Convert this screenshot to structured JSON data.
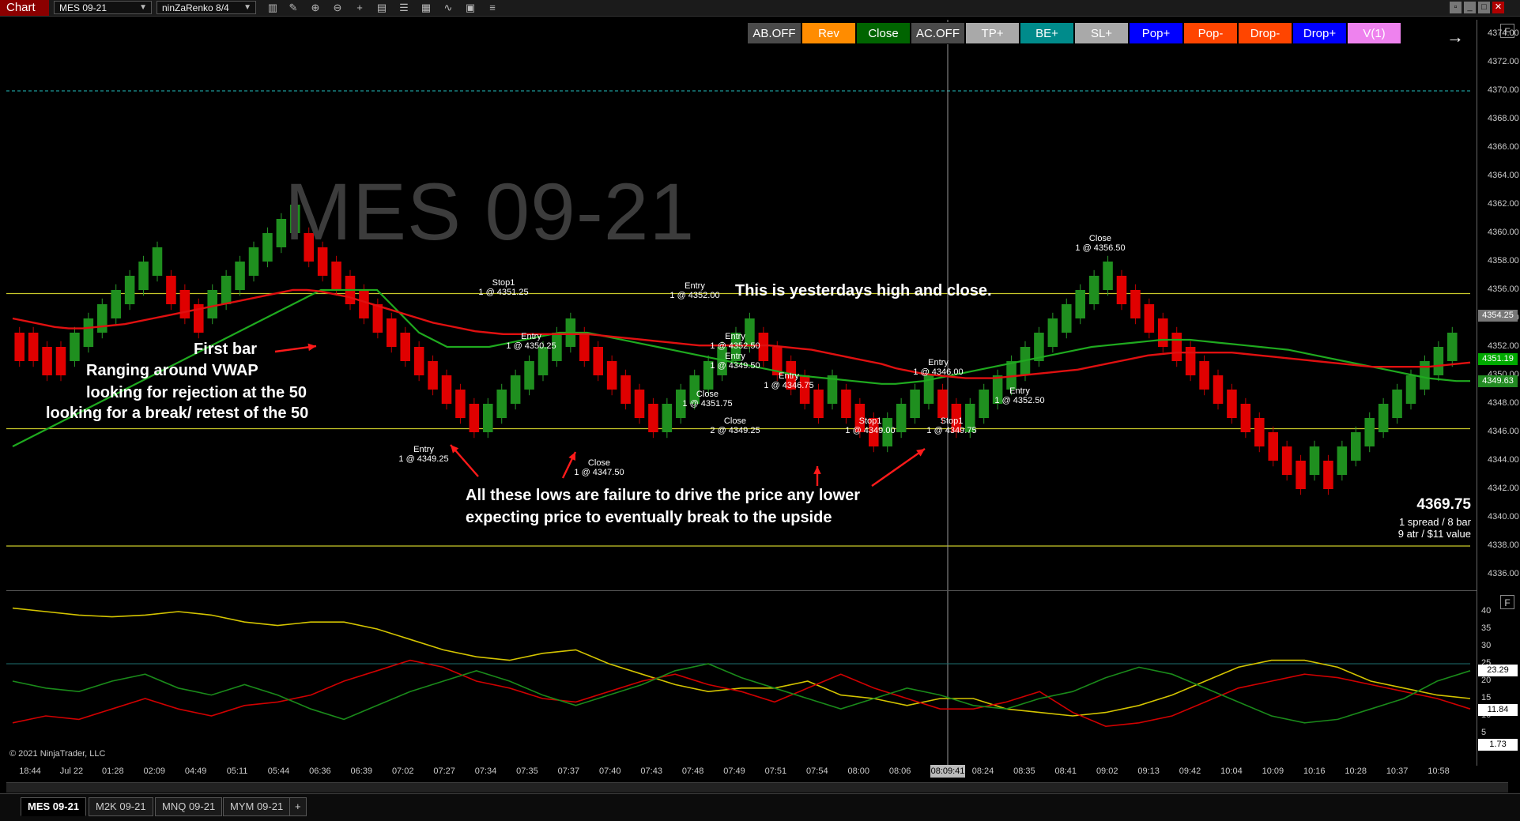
{
  "window": {
    "chart_tab": "Chart",
    "instrument": "MES 09-21",
    "bar_type": "ninZaRenko 8/4",
    "toolbar_icons": [
      "bar-type-icon",
      "pencil-icon",
      "zoom-in-icon",
      "zoom-out-icon",
      "crosshair-icon",
      "properties-icon",
      "data-series-icon",
      "indicators-icon",
      "strategies-icon",
      "templates-icon",
      "list-icon"
    ],
    "window_controls": [
      "tile-icon",
      "restore-icon",
      "maximize-icon",
      "close-icon"
    ]
  },
  "buttons": [
    {
      "label": "AB.OFF",
      "color": "#4a4a4a"
    },
    {
      "label": "Rev",
      "color": "#ff8c00"
    },
    {
      "label": "Close",
      "color": "#006400"
    },
    {
      "label": "AC.OFF",
      "color": "#4a4a4a"
    },
    {
      "label": "TP+",
      "color": "#a9a9a9"
    },
    {
      "label": "BE+",
      "color": "#008b8b"
    },
    {
      "label": "SL+",
      "color": "#a9a9a9"
    },
    {
      "label": "Pop+",
      "color": "#0000ff"
    },
    {
      "label": "Pop-",
      "color": "#ff4500"
    },
    {
      "label": "Drop-",
      "color": "#ff4500"
    },
    {
      "label": "Drop+",
      "color": "#0000ff"
    },
    {
      "label": "V(1)",
      "color": "#ee82ee"
    }
  ],
  "watermark": "MES 09-21",
  "annotations": {
    "yesterday": "This is yesterdays high and close.",
    "first_bar": "First bar",
    "ranging": "Ranging around VWAP",
    "rejection": "looking for rejection at the 50",
    "break_retest": "looking for a break/ retest of the 50",
    "lows1": "All these lows are failure to drive the price any lower",
    "lows2": "expecting price to eventually break to the upside"
  },
  "trade_labels": [
    {
      "title": "Stop1",
      "detail": "1 @ 4351.25"
    },
    {
      "title": "Entry",
      "detail": "1 @ 4350.25"
    },
    {
      "title": "Entry",
      "detail": "1 @ 4349.25"
    },
    {
      "title": "Close",
      "detail": "1 @ 4347.50"
    },
    {
      "title": "Entry",
      "detail": "1 @ 4352.00"
    },
    {
      "title": "Entry",
      "detail": "1 @ 4352.50"
    },
    {
      "title": "Entry",
      "detail": "1 @ 4349.50"
    },
    {
      "title": "Close",
      "detail": "1 @ 4351.75"
    },
    {
      "title": "Close",
      "detail": "2 @ 4349.25"
    },
    {
      "title": "Entry",
      "detail": "1 @ 4346.75"
    },
    {
      "title": "Stop1",
      "detail": "1 @ 4349.00"
    },
    {
      "title": "Entry",
      "detail": "1 @ 4346.00"
    },
    {
      "title": "Stop1",
      "detail": "1 @ 4349.75"
    },
    {
      "title": "Entry",
      "detail": "1 @ 4352.50"
    },
    {
      "title": "Close",
      "detail": "1 @ 4356.50"
    }
  ],
  "info_panel": {
    "price": "4369.75",
    "line1": "1 spread / 8 bar",
    "line2": "9 atr / $11 value"
  },
  "price_axis": [
    "4374.00",
    "4372.00",
    "4370.00",
    "4368.00",
    "4366.00",
    "4364.00",
    "4362.00",
    "4360.00",
    "4358.00",
    "4356.00",
    "4354.00",
    "4352.00",
    "4350.00",
    "4348.00",
    "4346.00",
    "4344.00",
    "4342.00",
    "4340.00",
    "4338.00",
    "4336.00"
  ],
  "price_badges": [
    {
      "label": "4354.25",
      "bg": "#777777",
      "fg": "#ffffff"
    },
    {
      "label": "4351.19",
      "bg": "#00aa00",
      "fg": "#ffffff"
    },
    {
      "label": "4349.63",
      "bg": "#228b22",
      "fg": "#ffffff"
    }
  ],
  "osc_axis": [
    "40",
    "35",
    "30",
    "25",
    "20",
    "15",
    "10",
    "5"
  ],
  "osc_badges": [
    {
      "label": "23.29",
      "bg": "#ffffff",
      "fg": "#000000"
    },
    {
      "label": "11.84",
      "bg": "#ffffff",
      "fg": "#000000"
    },
    {
      "label": "1.73",
      "bg": "#ffffff",
      "fg": "#000000"
    }
  ],
  "time_axis": [
    "18:44",
    "Jul 22",
    "01:28",
    "02:09",
    "04:49",
    "05:11",
    "05:44",
    "06:36",
    "06:39",
    "07:02",
    "07:27",
    "07:34",
    "07:35",
    "07:37",
    "07:40",
    "07:43",
    "07:48",
    "07:49",
    "07:51",
    "07:54",
    "08:00",
    "08:06",
    "08:09:41",
    "08:24",
    "08:35",
    "08:41",
    "09:02",
    "09:13",
    "09:42",
    "10:04",
    "10:09",
    "10:16",
    "10:28",
    "10:37",
    "10:58"
  ],
  "copyright": "© 2021 NinjaTrader, LLC",
  "instrument_tabs": [
    "MES 09-21",
    "M2K 09-21",
    "MNQ 09-21",
    "MYM 09-21"
  ],
  "add_tab": "+",
  "panel_button": "F",
  "chart_data": {
    "type": "candlestick",
    "price_range": [
      4335,
      4375
    ],
    "candles": [
      {
        "o": 4353,
        "c": 4351
      },
      {
        "o": 4353,
        "c": 4351
      },
      {
        "o": 4352,
        "c": 4350
      },
      {
        "o": 4352,
        "c": 4350
      },
      {
        "o": 4351,
        "c": 4353
      },
      {
        "o": 4352,
        "c": 4354
      },
      {
        "o": 4353,
        "c": 4355
      },
      {
        "o": 4354,
        "c": 4356
      },
      {
        "o": 4355,
        "c": 4357
      },
      {
        "o": 4356,
        "c": 4358
      },
      {
        "o": 4357,
        "c": 4359
      },
      {
        "o": 4357,
        "c": 4355
      },
      {
        "o": 4356,
        "c": 4354
      },
      {
        "o": 4355,
        "c": 4353
      },
      {
        "o": 4354,
        "c": 4356
      },
      {
        "o": 4355,
        "c": 4357
      },
      {
        "o": 4356,
        "c": 4358
      },
      {
        "o": 4357,
        "c": 4359
      },
      {
        "o": 4358,
        "c": 4360
      },
      {
        "o": 4359,
        "c": 4361
      },
      {
        "o": 4360,
        "c": 4362
      },
      {
        "o": 4360,
        "c": 4358
      },
      {
        "o": 4359,
        "c": 4357
      },
      {
        "o": 4358,
        "c": 4356
      },
      {
        "o": 4357,
        "c": 4355
      },
      {
        "o": 4356,
        "c": 4354
      },
      {
        "o": 4355,
        "c": 4353
      },
      {
        "o": 4354,
        "c": 4352
      },
      {
        "o": 4353,
        "c": 4351
      },
      {
        "o": 4352,
        "c": 4350
      },
      {
        "o": 4351,
        "c": 4349
      },
      {
        "o": 4350,
        "c": 4348
      },
      {
        "o": 4349,
        "c": 4347
      },
      {
        "o": 4348,
        "c": 4346
      },
      {
        "o": 4346,
        "c": 4348
      },
      {
        "o": 4347,
        "c": 4349
      },
      {
        "o": 4348,
        "c": 4350
      },
      {
        "o": 4349,
        "c": 4351
      },
      {
        "o": 4350,
        "c": 4352
      },
      {
        "o": 4351,
        "c": 4353
      },
      {
        "o": 4352,
        "c": 4354
      },
      {
        "o": 4353,
        "c": 4351
      },
      {
        "o": 4352,
        "c": 4350
      },
      {
        "o": 4351,
        "c": 4349
      },
      {
        "o": 4350,
        "c": 4348
      },
      {
        "o": 4349,
        "c": 4347
      },
      {
        "o": 4348,
        "c": 4346
      },
      {
        "o": 4346,
        "c": 4348
      },
      {
        "o": 4347,
        "c": 4349
      },
      {
        "o": 4348,
        "c": 4350
      },
      {
        "o": 4349,
        "c": 4351
      },
      {
        "o": 4350,
        "c": 4352
      },
      {
        "o": 4351,
        "c": 4353
      },
      {
        "o": 4352,
        "c": 4354
      },
      {
        "o": 4353,
        "c": 4351
      },
      {
        "o": 4352,
        "c": 4350
      },
      {
        "o": 4351,
        "c": 4349
      },
      {
        "o": 4350,
        "c": 4348
      },
      {
        "o": 4349,
        "c": 4347
      },
      {
        "o": 4348,
        "c": 4350
      },
      {
        "o": 4349,
        "c": 4347
      },
      {
        "o": 4348,
        "c": 4346
      },
      {
        "o": 4347,
        "c": 4345
      },
      {
        "o": 4345,
        "c": 4347
      },
      {
        "o": 4346,
        "c": 4348
      },
      {
        "o": 4347,
        "c": 4349
      },
      {
        "o": 4348,
        "c": 4350
      },
      {
        "o": 4349,
        "c": 4347
      },
      {
        "o": 4348,
        "c": 4346
      },
      {
        "o": 4346,
        "c": 4348
      },
      {
        "o": 4347,
        "c": 4349
      },
      {
        "o": 4348,
        "c": 4350
      },
      {
        "o": 4349,
        "c": 4351
      },
      {
        "o": 4350,
        "c": 4352
      },
      {
        "o": 4351,
        "c": 4353
      },
      {
        "o": 4352,
        "c": 4354
      },
      {
        "o": 4353,
        "c": 4355
      },
      {
        "o": 4354,
        "c": 4356
      },
      {
        "o": 4355,
        "c": 4357
      },
      {
        "o": 4356,
        "c": 4358
      },
      {
        "o": 4357,
        "c": 4355
      },
      {
        "o": 4356,
        "c": 4354
      },
      {
        "o": 4355,
        "c": 4353
      },
      {
        "o": 4354,
        "c": 4352
      },
      {
        "o": 4353,
        "c": 4351
      },
      {
        "o": 4352,
        "c": 4350
      },
      {
        "o": 4351,
        "c": 4349
      },
      {
        "o": 4350,
        "c": 4348
      },
      {
        "o": 4349,
        "c": 4347
      },
      {
        "o": 4348,
        "c": 4346
      },
      {
        "o": 4347,
        "c": 4345
      },
      {
        "o": 4346,
        "c": 4344
      },
      {
        "o": 4345,
        "c": 4343
      },
      {
        "o": 4344,
        "c": 4342
      },
      {
        "o": 4343,
        "c": 4345
      },
      {
        "o": 4344,
        "c": 4342
      },
      {
        "o": 4343,
        "c": 4345
      },
      {
        "o": 4344,
        "c": 4346
      },
      {
        "o": 4345,
        "c": 4347
      },
      {
        "o": 4346,
        "c": 4348
      },
      {
        "o": 4347,
        "c": 4349
      },
      {
        "o": 4348,
        "c": 4350
      },
      {
        "o": 4349,
        "c": 4351
      },
      {
        "o": 4350,
        "c": 4352
      },
      {
        "o": 4351,
        "c": 4353
      }
    ],
    "horizontal_levels": [
      4355.75,
      4346.25,
      4338.0,
      4370.0
    ],
    "vwap": [
      4345,
      4345.5,
      4346,
      4346.5,
      4347,
      4347.5,
      4348,
      4348.5,
      4349,
      4349.5,
      4350,
      4350.5,
      4351,
      4351.5,
      4352,
      4352.5,
      4353,
      4353.5,
      4354,
      4354.5,
      4355,
      4355.5,
      4356,
      4356,
      4356,
      4356,
      4356,
      4355,
      4354,
      4353,
      4352.5,
      4352,
      4352,
      4352,
      4352,
      4352.2,
      4352.4,
      4352.6,
      4352.8,
      4353,
      4353,
      4353,
      4352.8,
      4352.6,
      4352.4,
      4352.2,
      4352,
      4351.8,
      4351.6,
      4351.4,
      4351.2,
      4351,
      4350.8,
      4350.6,
      4350.4,
      4350.2,
      4350,
      4349.9,
      4349.8,
      4349.7,
      4349.6,
      4349.5,
      4349.4,
      4349.4,
      4349.5,
      4349.6,
      4349.8,
      4350,
      4350.2,
      4350.4,
      4350.6,
      4350.8,
      4351,
      4351.2,
      4351.4,
      4351.6,
      4351.8,
      4352,
      4352.1,
      4352.2,
      4352.3,
      4352.4,
      4352.5,
      4352.5,
      4352.5,
      4352.4,
      4352.3,
      4352.2,
      4352.1,
      4352,
      4351.9,
      4351.8,
      4351.6,
      4351.4,
      4351.2,
      4351,
      4350.8,
      4350.6,
      4350.4,
      4350.2,
      4350,
      4349.8,
      4349.7,
      4349.6,
      4349.6
    ],
    "ema50": [
      4354,
      4353.8,
      4353.6,
      4353.4,
      4353.3,
      4353.3,
      4353.4,
      4353.5,
      4353.6,
      4353.8,
      4354,
      4354.2,
      4354.4,
      4354.6,
      4354.8,
      4355,
      4355.2,
      4355.4,
      4355.6,
      4355.8,
      4356,
      4356,
      4355.9,
      4355.7,
      4355.5,
      4355.2,
      4354.9,
      4354.6,
      4354.3,
      4354,
      4353.7,
      4353.5,
      4353.3,
      4353.1,
      4353,
      4352.9,
      4352.9,
      4352.9,
      4352.9,
      4352.9,
      4352.9,
      4352.9,
      4352.8,
      4352.7,
      4352.6,
      4352.5,
      4352.4,
      4352.3,
      4352.2,
      4352.1,
      4352.1,
      4352.1,
      4352.1,
      4352.1,
      4352.1,
      4352,
      4351.9,
      4351.8,
      4351.6,
      4351.4,
      4351.2,
      4351,
      4350.8,
      4350.5,
      4350.3,
      4350.1,
      4350,
      4349.9,
      4349.8,
      4349.8,
      4349.8,
      4349.9,
      4350,
      4350.1,
      4350.2,
      4350.3,
      4350.4,
      4350.6,
      4350.8,
      4351,
      4351.2,
      4351.4,
      4351.5,
      4351.6,
      4351.6,
      4351.6,
      4351.6,
      4351.6,
      4351.5,
      4351.4,
      4351.3,
      4351.2,
      4351.1,
      4351,
      4350.9,
      4350.8,
      4350.7,
      4350.6,
      4350.6,
      4350.6,
      4350.6,
      4350.6,
      4350.7,
      4350.8,
      4350.9
    ]
  },
  "oscillator_data": {
    "type": "line",
    "y_range": [
      0,
      45
    ],
    "series": [
      {
        "color": "#d4c400",
        "values": [
          41,
          40,
          39,
          38.5,
          39,
          40,
          39,
          37,
          36,
          37,
          37,
          35,
          32,
          29,
          27,
          26,
          28,
          29,
          25,
          22,
          19,
          17,
          18,
          18,
          20,
          16,
          15,
          13,
          15,
          15,
          12,
          11,
          10,
          11,
          13,
          16,
          20,
          24,
          26,
          26,
          24,
          20,
          18,
          16,
          15
        ]
      },
      {
        "color": "#d00000",
        "values": [
          8,
          10,
          9,
          12,
          15,
          12,
          10,
          13,
          14,
          16,
          20,
          23,
          26,
          24,
          20,
          18,
          15,
          14,
          17,
          20,
          22,
          19,
          17,
          14,
          18,
          22,
          18,
          15,
          12,
          12,
          14,
          17,
          11,
          7,
          8,
          10,
          14,
          18,
          20,
          22,
          21,
          19,
          17,
          15,
          12
        ]
      },
      {
        "color": "#1a8a1a",
        "values": [
          20,
          18,
          17,
          20,
          22,
          18,
          16,
          19,
          16,
          12,
          9,
          13,
          17,
          20,
          23,
          20,
          16,
          13,
          16,
          19,
          23,
          25,
          21,
          18,
          15,
          12,
          15,
          18,
          16,
          13,
          12,
          15,
          17,
          21,
          24,
          22,
          18,
          14,
          10,
          8,
          9,
          12,
          15,
          20,
          23
        ]
      }
    ]
  }
}
